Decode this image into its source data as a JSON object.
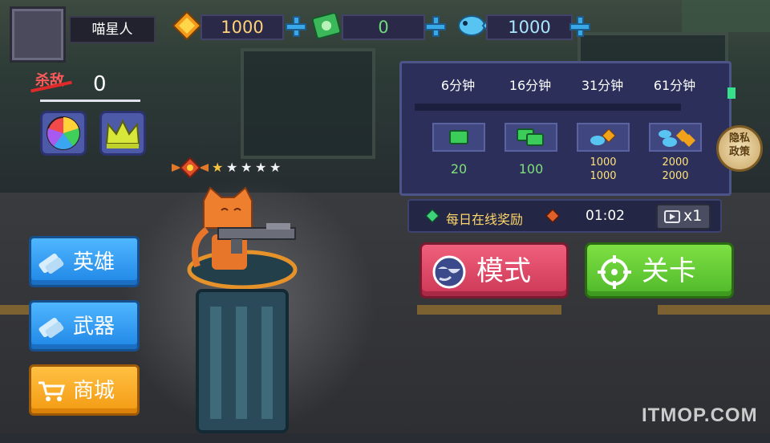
{
  "player": {
    "name": "喵星人"
  },
  "resources": {
    "gold": {
      "icon": "gold-gem-icon",
      "value": "1000"
    },
    "cash": {
      "icon": "cash-stack-icon",
      "value": "0"
    },
    "fish": {
      "icon": "fish-icon",
      "value": "1000"
    }
  },
  "kills": {
    "label": "杀敌",
    "value": "0"
  },
  "rank": {
    "stars_total": 5,
    "stars_filled": 1
  },
  "side_menu": {
    "hero": "英雄",
    "weapon": "武器",
    "shop": "商城"
  },
  "online_reward": {
    "times": [
      "6分钟",
      "16分钟",
      "31分钟",
      "61分钟"
    ],
    "rewards": [
      {
        "icon": "cash-icon",
        "amount": "20"
      },
      {
        "icon": "cash-bundle-icon",
        "amount": "100"
      },
      {
        "icon": "fish-gold-icon",
        "amount_fish": "1000",
        "amount_gold": "1000"
      },
      {
        "icon": "fish-gold-pile-icon",
        "amount_fish": "2000",
        "amount_gold": "2000"
      }
    ],
    "daily_label": "每日在线奖励",
    "countdown": "01:02",
    "ad_multiplier": "x1"
  },
  "privacy": {
    "line1": "隐私",
    "line2": "政策"
  },
  "actions": {
    "mode": "模式",
    "stage": "关卡"
  },
  "watermark": "ITMOP.COM",
  "colors": {
    "mode_button": "#e04a68",
    "stage_button": "#66cc36",
    "side_button_blue": "#2f9bf0",
    "shop_button": "#f7a91e",
    "panel_bg": "#2b2f5a"
  }
}
